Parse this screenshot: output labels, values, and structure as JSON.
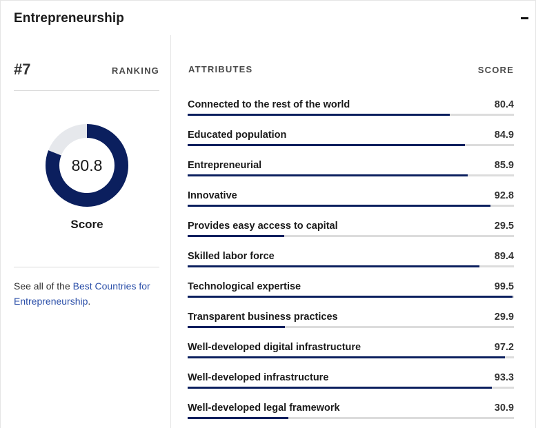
{
  "header": {
    "title": "Entrepreneurship"
  },
  "ranking": {
    "number": "#7",
    "label": "RANKING"
  },
  "donut": {
    "value": 80.8,
    "display": "80.8",
    "label": "Score",
    "fill_color": "#0b1f5e",
    "track_color": "#e6e8ec"
  },
  "see_all": {
    "prefix": "See all of the ",
    "link_text": "Best Countries for Entrepreneurship",
    "suffix": "."
  },
  "table": {
    "attr_header": "ATTRIBUTES",
    "score_header": "SCORE",
    "bar_color": "#0b1f5e",
    "rows": [
      {
        "name": "Connected to the rest of the world",
        "score": "80.4",
        "value": 80.4
      },
      {
        "name": "Educated population",
        "score": "84.9",
        "value": 84.9
      },
      {
        "name": "Entrepreneurial",
        "score": "85.9",
        "value": 85.9
      },
      {
        "name": "Innovative",
        "score": "92.8",
        "value": 92.8
      },
      {
        "name": "Provides easy access to capital",
        "score": "29.5",
        "value": 29.5
      },
      {
        "name": "Skilled labor force",
        "score": "89.4",
        "value": 89.4
      },
      {
        "name": "Technological expertise",
        "score": "99.5",
        "value": 99.5
      },
      {
        "name": "Transparent business practices",
        "score": "29.9",
        "value": 29.9
      },
      {
        "name": "Well-developed digital infrastructure",
        "score": "97.2",
        "value": 97.2
      },
      {
        "name": "Well-developed infrastructure",
        "score": "93.3",
        "value": 93.3
      },
      {
        "name": "Well-developed legal framework",
        "score": "30.9",
        "value": 30.9
      }
    ]
  }
}
